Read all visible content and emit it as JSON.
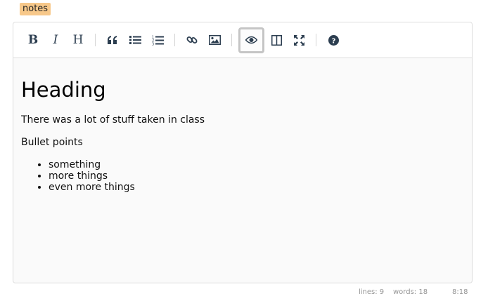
{
  "tag": {
    "label": "notes"
  },
  "toolbar": {
    "buttons": [
      {
        "name": "bold-button",
        "icon": "bold-icon",
        "glyph": "B"
      },
      {
        "name": "italic-button",
        "icon": "italic-icon",
        "glyph": "I"
      },
      {
        "name": "heading-button",
        "icon": "heading-icon",
        "glyph": "H"
      },
      {
        "name": "quote-button",
        "icon": "quote-icon",
        "glyph": "❝"
      },
      {
        "name": "unordered-list-button",
        "icon": "list-ul-icon",
        "glyph": "☰"
      },
      {
        "name": "ordered-list-button",
        "icon": "list-ol-icon",
        "glyph": "☷"
      },
      {
        "name": "link-button",
        "icon": "link-icon",
        "glyph": "🔗"
      },
      {
        "name": "image-button",
        "icon": "image-icon",
        "glyph": "🖼"
      },
      {
        "name": "preview-button",
        "icon": "eye-icon",
        "glyph": "👁",
        "active": true
      },
      {
        "name": "side-by-side-button",
        "icon": "columns-icon",
        "glyph": "▥"
      },
      {
        "name": "fullscreen-button",
        "icon": "expand-icon",
        "glyph": "✥"
      },
      {
        "name": "guide-button",
        "icon": "question-circle-icon",
        "glyph": "?"
      }
    ],
    "icon_color": "#2c3e50"
  },
  "preview": {
    "heading": "Heading",
    "paragraph_1": "There was a lot of stuff taken in class",
    "paragraph_2": "Bullet points",
    "bullets": [
      "something",
      "more things",
      "even more things"
    ]
  },
  "status": {
    "lines": "lines: 9",
    "words": "words: 18",
    "cursor": "8:18"
  },
  "colors": {
    "tag_bg": "#f7c88a",
    "editor_bg": "#fafafa",
    "border": "#dddddd",
    "status_text": "#959595"
  }
}
